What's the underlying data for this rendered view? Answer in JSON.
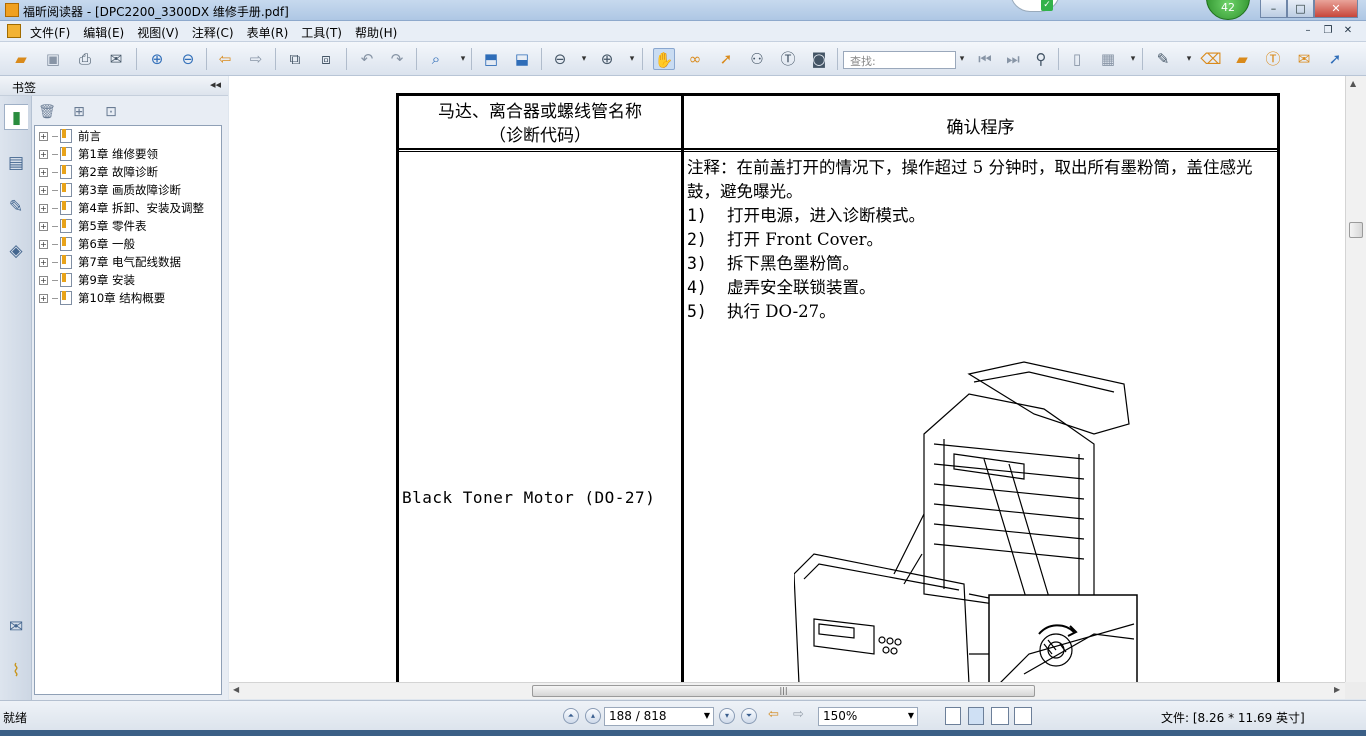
{
  "window": {
    "title": "福昕阅读器 - [DPC2200_3300DX 维修手册.pdf]",
    "notification_count": "42",
    "controls": [
      "–",
      "□",
      "✕"
    ]
  },
  "menu": {
    "items": [
      "文件(F)",
      "编辑(E)",
      "视图(V)",
      "注释(C)",
      "表单(R)",
      "工具(T)",
      "帮助(H)"
    ],
    "doc_controls": [
      "–",
      "❐",
      "✕"
    ]
  },
  "toolbar": {
    "search_placeholder": "查找:"
  },
  "bookmarks": {
    "header": "书签",
    "items": [
      "前言",
      "第1章 维修要领",
      "第2章 故障诊断",
      "第3章 画质故障诊断",
      "第4章 拆卸、安装及调整",
      "第5章 零件表",
      "第6章 一般",
      "第7章 电气配线数据",
      "第9章 安装",
      "第10章 结构概要"
    ]
  },
  "document": {
    "col1_header_line1": "马达、离合器或螺线管名称",
    "col1_header_line2": "（诊断代码）",
    "col2_header": "确认程序",
    "motor_name": "Black Toner Motor (DO-27)",
    "note": "注释：在前盖打开的情况下，操作超过 5 分钟时，取出所有墨粉筒，盖住感光鼓，避免曝光。",
    "steps": [
      {
        "num": "1)",
        "text": "打开电源，进入诊断模式。"
      },
      {
        "num": "2)",
        "text": "打开 Front Cover。"
      },
      {
        "num": "3)",
        "text": "拆下黑色墨粉筒。"
      },
      {
        "num": "4)",
        "text": "虚弄安全联锁装置。"
      },
      {
        "num": "5)",
        "text": "执行 DO-27。"
      }
    ]
  },
  "statusbar": {
    "status": "就绪",
    "page": "188 / 818",
    "zoom": "150%",
    "file_info": "文件: [8.26 * 11.69 英寸]"
  },
  "colors": {
    "accent": "#2f6db8",
    "bookmark_flag": "#e8a31a",
    "page_bg": "#ffffff",
    "chrome_bg": "#dfe6ee"
  }
}
